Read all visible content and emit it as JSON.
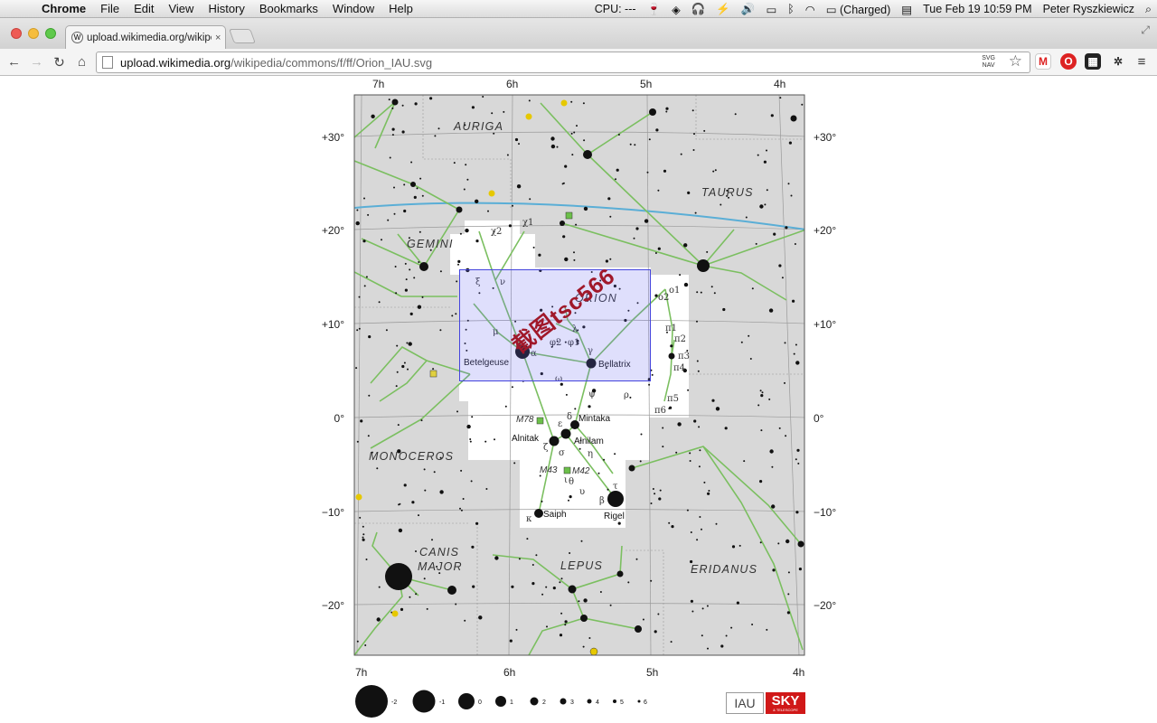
{
  "menubar": {
    "app": "Chrome",
    "items": [
      "File",
      "Edit",
      "View",
      "History",
      "Bookmarks",
      "Window",
      "Help"
    ],
    "cpu": "CPU: ---",
    "battery": "(Charged)",
    "datetime": "Tue Feb 19  10:59 PM",
    "user": "Peter Ryszkiewicz"
  },
  "tab": {
    "title": "upload.wikimedia.org/wikipe",
    "close": "×"
  },
  "address": {
    "host": "upload.wikimedia.org",
    "path": "/wikipedia/commons/f/ff/Orion_IAU.svg"
  },
  "toolbar": {
    "svgnav_top": "SVG",
    "svgnav_bottom": "NAV"
  },
  "extensions": [
    "gmail-icon",
    "opera-icon",
    "grid-icon",
    "puzzle-icon",
    "menu-icon"
  ],
  "colors": {
    "map_gray": "#d8d8d8",
    "constellation_line": "#7bbf60",
    "ecliptic": "#5aaed6",
    "star": "#111111",
    "selection": "#4444dd",
    "watermark": "#a0182a"
  },
  "chart": {
    "ra_labels": [
      "7h",
      "6h",
      "5h",
      "4h"
    ],
    "dec_labels": [
      "+30°",
      "+20°",
      "+10°",
      "0°",
      "−10°",
      "−20°"
    ],
    "constellations": [
      "AURIGA",
      "TAURUS",
      "GEMINI",
      "ORION",
      "MONOCEROS",
      "CANIS MAJOR",
      "LEPUS",
      "ERIDANUS"
    ],
    "star_names": [
      "Betelgeuse",
      "Bellatrix",
      "Mintaka",
      "Alnitak",
      "Alnilam",
      "Saiph",
      "Rigel"
    ],
    "greek": [
      "χ2",
      "χ1",
      "ξ",
      "ν",
      "μ",
      "λ",
      "φ2",
      "φ1",
      "α",
      "γ",
      "ω",
      "ψ",
      "ρ",
      "δ",
      "ε",
      "ζ",
      "σ",
      "η",
      "ι",
      "θ",
      "υ",
      "τ",
      "β",
      "κ",
      "o1",
      "o2",
      "π1",
      "π2",
      "π3",
      "π4",
      "π5",
      "π6"
    ],
    "deep_sky": [
      "M78",
      "M43",
      "M42"
    ],
    "magnitude_legend": [
      "-2",
      "-1",
      "0",
      "1",
      "2",
      "3",
      "4",
      "5",
      "6"
    ]
  },
  "watermark": "截图tsc566",
  "logos": {
    "iau": "IAU",
    "sky": "SKY",
    "sky_sub": "& TELESCOPE"
  }
}
